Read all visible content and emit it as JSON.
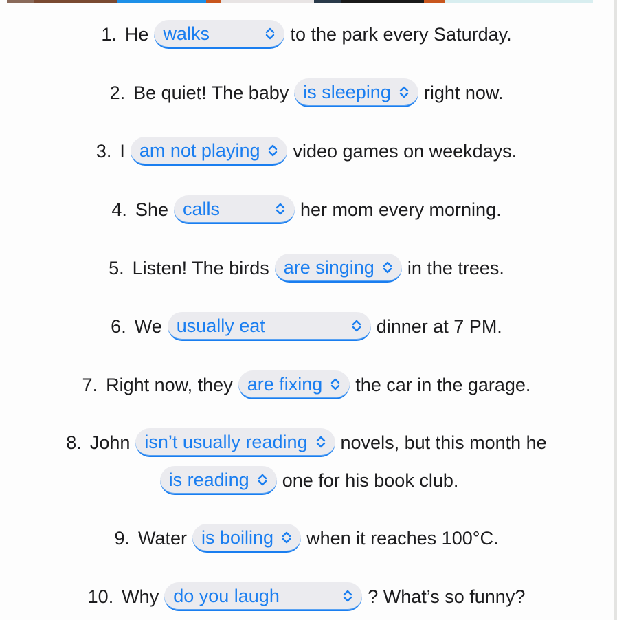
{
  "colors": {
    "accent": "#1a7ef0",
    "select_bg": "#ebebef",
    "text": "#1c1c1e"
  },
  "top_strip_colors": [
    "#8a6a5a",
    "#7a4a32",
    "#1e90e8",
    "#c8561e",
    "#e8e4e4",
    "#2a3a4a",
    "#1a1a1a",
    "#c8561e",
    "#d8eef0"
  ],
  "exercises": [
    {
      "num": "1.",
      "lines": [
        {
          "before": "He",
          "select": "walks",
          "after": "to the park every Saturday."
        }
      ]
    },
    {
      "num": "2.",
      "lines": [
        {
          "before": "Be quiet! The baby",
          "select": "is sleeping",
          "after": "right now."
        }
      ]
    },
    {
      "num": "3.",
      "lines": [
        {
          "before": "I",
          "select": "am not playing",
          "after": "video games on weekdays."
        }
      ]
    },
    {
      "num": "4.",
      "lines": [
        {
          "before": "She",
          "select": "calls",
          "after": "her mom every morning."
        }
      ]
    },
    {
      "num": "5.",
      "lines": [
        {
          "before": "Listen! The birds",
          "select": "are singing",
          "after": "in the trees."
        }
      ]
    },
    {
      "num": "6.",
      "lines": [
        {
          "before": "We",
          "select": "usually eat",
          "after": "dinner at 7 PM."
        }
      ]
    },
    {
      "num": "7.",
      "lines": [
        {
          "before": "Right now, they",
          "select": "are fixing",
          "after": "the car in the garage."
        }
      ]
    },
    {
      "num": "8.",
      "lines": [
        {
          "before": "John",
          "select": "isn’t usually reading",
          "after": "novels, but this month he"
        },
        {
          "before": "",
          "select": "is reading",
          "after": "one for his book club."
        }
      ]
    },
    {
      "num": "9.",
      "lines": [
        {
          "before": "Water",
          "select": "is boiling",
          "after": "when it reaches 100°C."
        }
      ]
    },
    {
      "num": "10.",
      "lines": [
        {
          "before": "Why",
          "select": "do you laugh",
          "after": "? What’s so funny?"
        }
      ]
    }
  ]
}
